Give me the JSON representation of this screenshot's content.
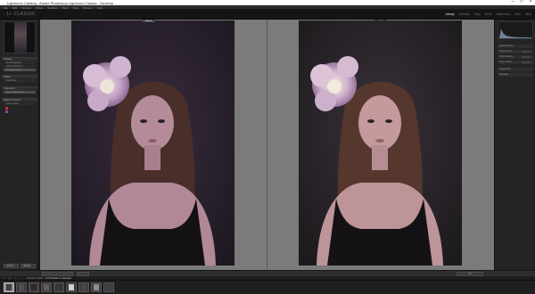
{
  "window": {
    "title": "Lightroom Catalog - Adobe Photoshop Lightroom Classic - Develop"
  },
  "menu": [
    "File",
    "Edit",
    "Develop",
    "Photo",
    "Settings",
    "Tools",
    "View",
    "Window",
    "Help"
  ],
  "identity_plate": "Lr CLASSIC",
  "modules": [
    {
      "label": "Library",
      "active": true
    },
    {
      "label": "Develop",
      "active": false
    },
    {
      "label": "Map",
      "active": false
    },
    {
      "label": "Book",
      "active": false
    },
    {
      "label": "Slideshow",
      "active": false
    },
    {
      "label": "Print",
      "active": false
    },
    {
      "label": "Web",
      "active": false
    }
  ],
  "left_panel": {
    "sections": [
      "Catalog",
      "Folders",
      "Collections",
      "Publish Services"
    ],
    "rows": [
      "All Photographs",
      "Quick Collection +",
      "Previous Import",
      "Smart Collections",
      "Hard Drive",
      "Adobe Stock"
    ],
    "buttons": {
      "import": "Import...",
      "export": "Export..."
    }
  },
  "view": {
    "before_label": "Before",
    "after_label": "After"
  },
  "right_panel": {
    "rows": [
      "Quick Develop",
      "Saved Preset",
      "White Balance",
      "Tone Control",
      "Keywording",
      "Metadata"
    ]
  },
  "toolbar": {
    "zoom_label": "Fit"
  },
  "filmstrip_bar": {
    "nav_primary": "1",
    "nav_secondary": "2",
    "crumb_prefix": "Previous Import",
    "crumb_file": "1 of 8 photos / 1 selected"
  },
  "filmstrip": {
    "thumbnails": 9
  },
  "colors": {
    "accent": "#c9a7d8",
    "background": "#7b7b7b"
  }
}
